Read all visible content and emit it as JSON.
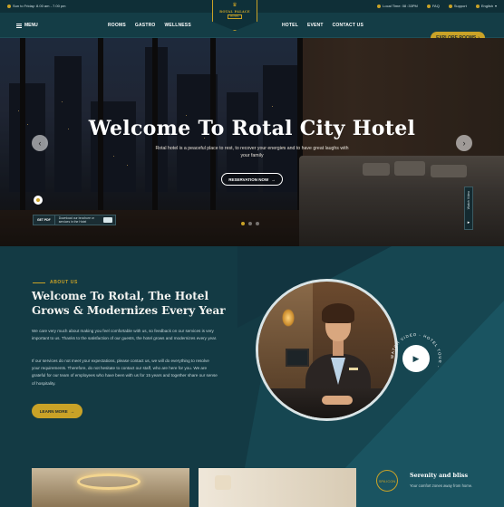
{
  "topbar": {
    "hours": "Sun to Friday: 8.00 am - 7.00 pm",
    "local_time": "Local Time: 08 :33PM",
    "faq": "FAQ",
    "support": "Support",
    "language": "English"
  },
  "nav": {
    "menu_label": "MENU",
    "left_links": [
      "ROOMS",
      "GASTRO",
      "WELLNESS"
    ],
    "right_links": [
      "HOTEL",
      "EVENT",
      "CONTACT US"
    ],
    "logo_name": "ROTAL PALACE",
    "logo_sub": "HOTEL",
    "explore_label": "EXPLORE ROOMS"
  },
  "hero": {
    "title": "Welcome To Rotal City Hotel",
    "subtitle": "Rotal hotel is a peaceful place to rest, to recover your energies and to have great laughs with your family",
    "reservation_label": "RESERVATION NOW",
    "popup_label": "GET PDF",
    "popup_text": "Download our brochure or services in the Hotel",
    "side_tab_label": "Watch Video",
    "active_slide": 0,
    "slide_count": 3
  },
  "about": {
    "eyebrow": "ABOUT US",
    "heading_line1": "Welcome To Rotal, The Hotel",
    "heading_line2": "Grows & Modernizes Every Year",
    "para1": "We care very much about making you feel comfortable with us, so feedback on our services is very important to us. Thanks to the satisfaction of our guests, the hotel grows and modernizes every year.",
    "para2": "If our services do not meet your expectations, please contact us, we will do everything to resolve your requirements. Therefore, do not hesitate to contact our staff, who are here for you. We are grateful for our team of employees who have been with us for 15 years and together share our sense of hospitality.",
    "learn_more_label": "LEARN MORE",
    "circle_text": "WATCH VIDEO - HOTEL TOUR - "
  },
  "feature": {
    "icon_text": "SPA ICON",
    "title": "Serenity and bliss",
    "text": "Your comfort zones away from home."
  },
  "colors": {
    "accent": "#c9a227",
    "bg_dark": "#143d46",
    "topbar": "#0f2f37"
  }
}
